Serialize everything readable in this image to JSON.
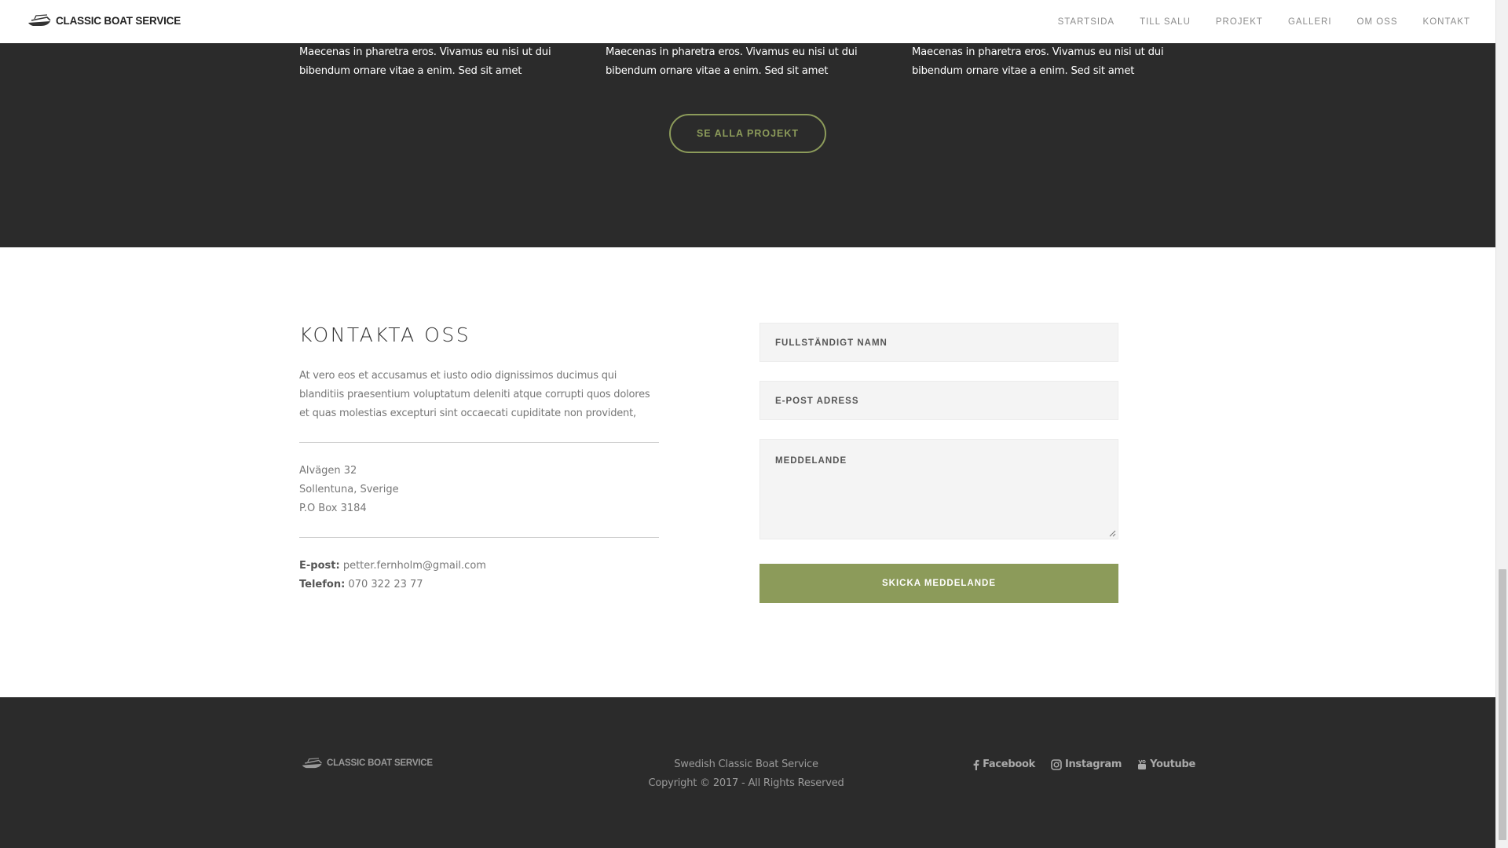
{
  "header": {
    "logo_text": "CLASSIC BOAT SERVICE",
    "nav": [
      "STARTSIDA",
      "TILL SALU",
      "PROJEKT",
      "GALLERI",
      "OM OSS",
      "KONTAKT"
    ]
  },
  "projects": {
    "items": [
      {
        "text": "Maecenas in pharetra eros. Vivamus eu nisi ut dui bibendum ornare vitae a enim. Sed sit amet"
      },
      {
        "text": "Maecenas in pharetra eros. Vivamus eu nisi ut dui bibendum ornare vitae a enim. Sed sit amet"
      },
      {
        "text": "Maecenas in pharetra eros. Vivamus eu nisi ut dui bibendum ornare vitae a enim. Sed sit amet"
      }
    ],
    "button_label": "SE ALLA PROJEKT"
  },
  "contact": {
    "title": "KONTAKTA OSS",
    "description": "At vero eos et accusamus et iusto odio dignissimos ducimus qui blanditiis praesentium voluptatum deleniti atque corrupti quos dolores et quas molestias excepturi sint occaecati cupiditate non provident,",
    "address": [
      "Alvägen 32",
      "Sollentuna, Sverige",
      "P.O Box 3184"
    ],
    "email_label": "E-post:",
    "email_value": "petter.fernholm@gmail.com",
    "phone_label": "Telefon:",
    "phone_value": "070 322 23 77"
  },
  "form": {
    "name_placeholder": "FULLSTÄNDIGT NAMN",
    "email_placeholder": "E-POST ADRESS",
    "message_placeholder": "MEDDELANDE",
    "submit_label": "SKICKA MEDDELANDE"
  },
  "footer": {
    "logo_text": "CLASSIC BOAT SERVICE",
    "line1": "Swedish Classic Boat Service",
    "line2": "Copyright © 2017 - All Rights Reserved",
    "social": [
      {
        "label": "Facebook",
        "icon": "facebook-icon"
      },
      {
        "label": "Instagram",
        "icon": "instagram-icon"
      },
      {
        "label": "Youtube",
        "icon": "youtube-icon"
      }
    ]
  },
  "colors": {
    "accent": "#8c9b5a",
    "dark": "#2b2b2b"
  }
}
